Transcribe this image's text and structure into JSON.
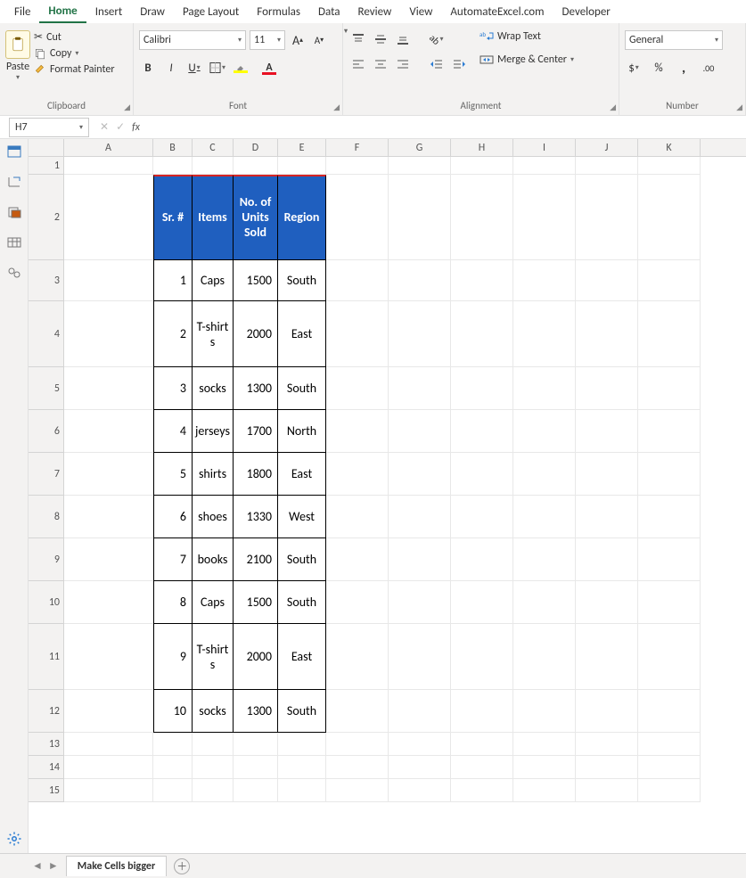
{
  "tabs": [
    "File",
    "Home",
    "Insert",
    "Draw",
    "Page Layout",
    "Formulas",
    "Data",
    "Review",
    "View",
    "AutomateExcel.com",
    "Developer"
  ],
  "activeTab": "Home",
  "ribbon": {
    "clipboard": {
      "label": "Clipboard",
      "paste": "Paste",
      "cut": "Cut",
      "copy": "Copy",
      "fmt": "Format Painter"
    },
    "font": {
      "label": "Font",
      "name": "Calibri",
      "size": "11"
    },
    "alignment": {
      "label": "Alignment",
      "wrap": "Wrap Text",
      "merge": "Merge & Center"
    },
    "number": {
      "label": "Number",
      "format": "General"
    }
  },
  "namebox": "H7",
  "formula": "",
  "cols": [
    {
      "l": "A",
      "w": 100
    },
    {
      "l": "B",
      "w": 44
    },
    {
      "l": "C",
      "w": 46
    },
    {
      "l": "D",
      "w": 50
    },
    {
      "l": "E",
      "w": 54
    },
    {
      "l": "F",
      "w": 70
    },
    {
      "l": "G",
      "w": 70
    },
    {
      "l": "H",
      "w": 70
    },
    {
      "l": "I",
      "w": 70
    },
    {
      "l": "J",
      "w": 70
    },
    {
      "l": "K",
      "w": 70
    }
  ],
  "headerRow": {
    "h": 96,
    "cells": [
      "Sr. #",
      "Items",
      "No. of Units Sold",
      "Region"
    ]
  },
  "dataRows": [
    {
      "h": 46,
      "r": [
        "1",
        "Caps",
        "1500",
        "South"
      ]
    },
    {
      "h": 74,
      "r": [
        "2",
        "T-shirts",
        "2000",
        "East"
      ]
    },
    {
      "h": 48,
      "r": [
        "3",
        "socks",
        "1300",
        "South"
      ]
    },
    {
      "h": 48,
      "r": [
        "4",
        "jerseys",
        "1700",
        "North"
      ]
    },
    {
      "h": 48,
      "r": [
        "5",
        "shirts",
        "1800",
        "East"
      ]
    },
    {
      "h": 48,
      "r": [
        "6",
        "shoes",
        "1330",
        "West"
      ]
    },
    {
      "h": 48,
      "r": [
        "7",
        "books",
        "2100",
        "South"
      ]
    },
    {
      "h": 48,
      "r": [
        "8",
        "Caps",
        "1500",
        "South"
      ]
    },
    {
      "h": 74,
      "r": [
        "9",
        "T-shirts",
        "2000",
        "East"
      ]
    },
    {
      "h": 48,
      "r": [
        "10",
        "socks",
        "1300",
        "South"
      ]
    }
  ],
  "emptyRowH": 26,
  "row1H": 20,
  "totalRows": 15,
  "sheetTab": "Make Cells bigger"
}
